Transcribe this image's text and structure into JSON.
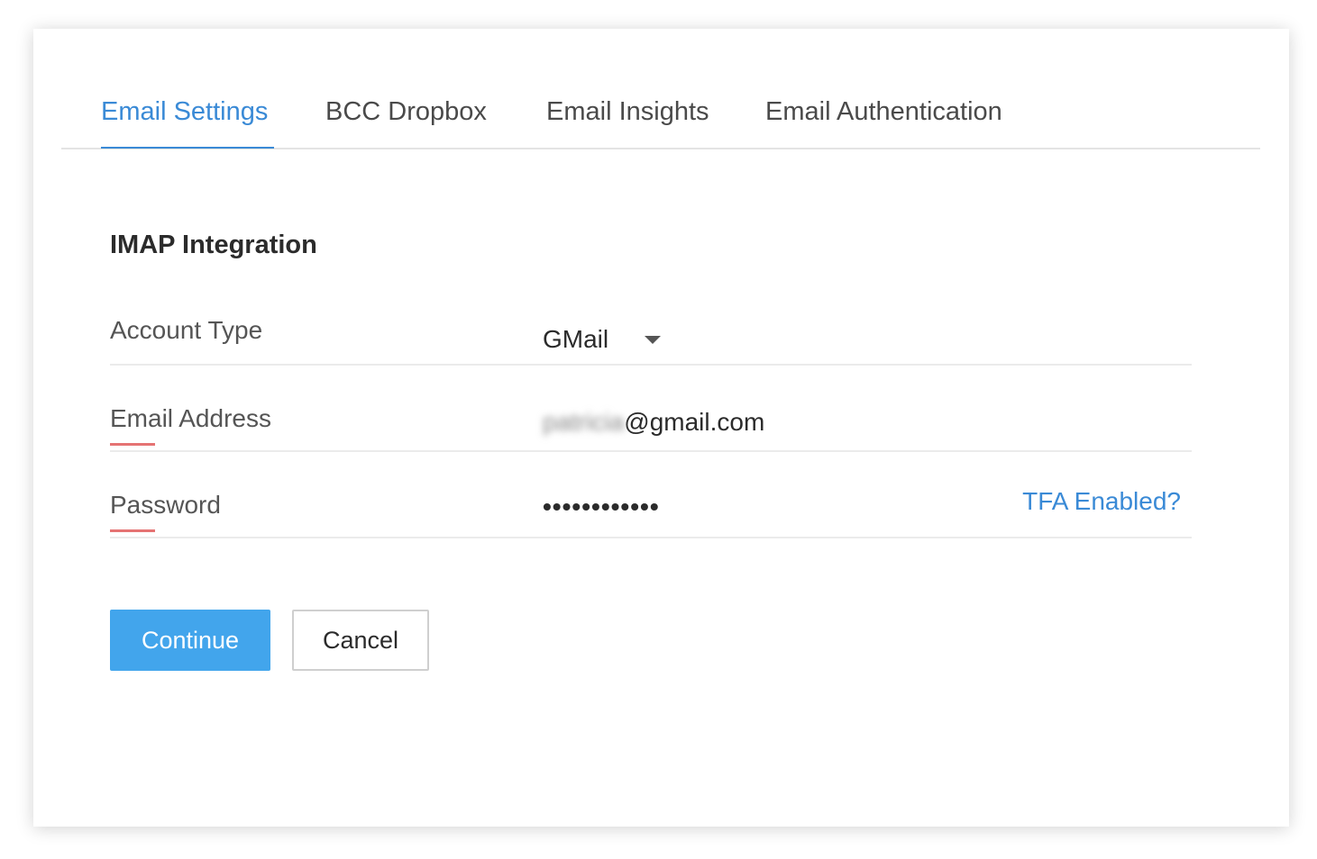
{
  "tabs": [
    {
      "label": "Email Settings",
      "active": true
    },
    {
      "label": "BCC Dropbox",
      "active": false
    },
    {
      "label": "Email Insights",
      "active": false
    },
    {
      "label": "Email Authentication",
      "active": false
    }
  ],
  "section": {
    "title": "IMAP Integration"
  },
  "form": {
    "account_type": {
      "label": "Account Type",
      "value": "GMail"
    },
    "email": {
      "label": "Email Address",
      "user_blurred": "patricia",
      "domain": "@gmail.com",
      "required": true
    },
    "password": {
      "label": "Password",
      "value": "••••••••••••",
      "required": true,
      "tfa_link": "TFA Enabled?"
    }
  },
  "actions": {
    "continue_label": "Continue",
    "cancel_label": "Cancel"
  },
  "colors": {
    "accent": "#3a8ad6",
    "primary_button": "#42a5ec",
    "required": "#e57373"
  }
}
